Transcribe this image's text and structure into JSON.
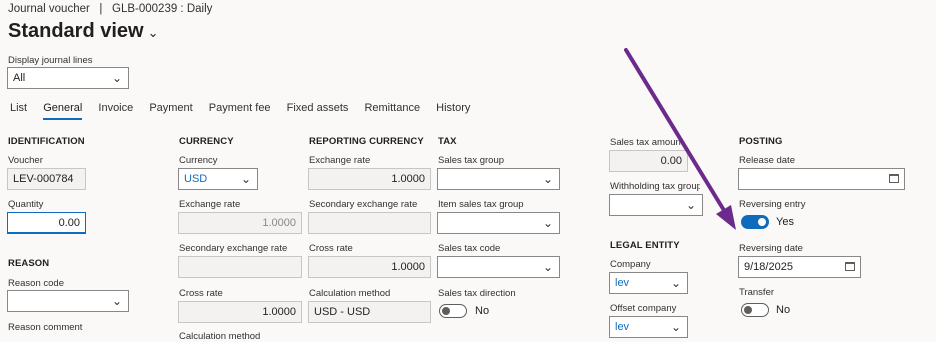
{
  "breadcrumb": {
    "module": "Journal voucher",
    "separator": "|",
    "record": "GLB-000239 : Daily"
  },
  "page_title": "Standard view",
  "display_lines": {
    "label": "Display journal lines",
    "value": "All"
  },
  "tabs": [
    "List",
    "General",
    "Invoice",
    "Payment",
    "Payment fee",
    "Fixed assets",
    "Remittance",
    "History"
  ],
  "identification": {
    "header": "IDENTIFICATION",
    "voucher_label": "Voucher",
    "voucher_value": "LEV-000784",
    "quantity_label": "Quantity",
    "quantity_value": "0.00"
  },
  "reason": {
    "header": "REASON",
    "reason_code_label": "Reason code",
    "reason_code_value": "",
    "reason_comment_label": "Reason comment"
  },
  "currency": {
    "header": "CURRENCY",
    "currency_label": "Currency",
    "currency_value": "USD",
    "exchange_rate_label": "Exchange rate",
    "exchange_rate_value": "1.0000",
    "secondary_rate_label": "Secondary exchange rate",
    "secondary_rate_value": "",
    "cross_rate_label": "Cross rate",
    "cross_rate_value": "1.0000",
    "calc_method_label": "Calculation method"
  },
  "reporting_currency": {
    "header": "REPORTING CURRENCY",
    "exchange_rate_label": "Exchange rate",
    "exchange_rate_value": "1.0000",
    "secondary_rate_label": "Secondary exchange rate",
    "secondary_rate_value": "",
    "cross_rate_label": "Cross rate",
    "cross_rate_value": "1.0000",
    "calc_method_label": "Calculation method",
    "calc_method_value": "USD - USD"
  },
  "tax": {
    "header": "TAX",
    "sales_tax_group_label": "Sales tax group",
    "item_sales_tax_group_label": "Item sales tax group",
    "sales_tax_code_label": "Sales tax code",
    "sales_tax_direction_label": "Sales tax direction",
    "sales_tax_direction_value": "No"
  },
  "tax2": {
    "sales_tax_amount_label": "Sales tax amount",
    "sales_tax_amount_value": "0.00",
    "withholding_label": "Withholding tax group"
  },
  "legal_entity": {
    "header": "LEGAL ENTITY",
    "company_label": "Company",
    "company_value": "lev",
    "offset_company_label": "Offset company",
    "offset_company_value": "lev"
  },
  "posting": {
    "header": "POSTING",
    "release_date_label": "Release date",
    "release_date_value": "",
    "reversing_entry_label": "Reversing entry",
    "reversing_entry_value": "Yes",
    "reversing_date_label": "Reversing date",
    "reversing_date_value": "9/18/2025",
    "transfer_label": "Transfer",
    "transfer_value": "No"
  },
  "colors": {
    "accent": "#0f6cbd",
    "annotation_arrow": "#6b2a8c"
  },
  "icons": {
    "dropdown": "chevron-down-icon",
    "calendar": "calendar-icon"
  }
}
